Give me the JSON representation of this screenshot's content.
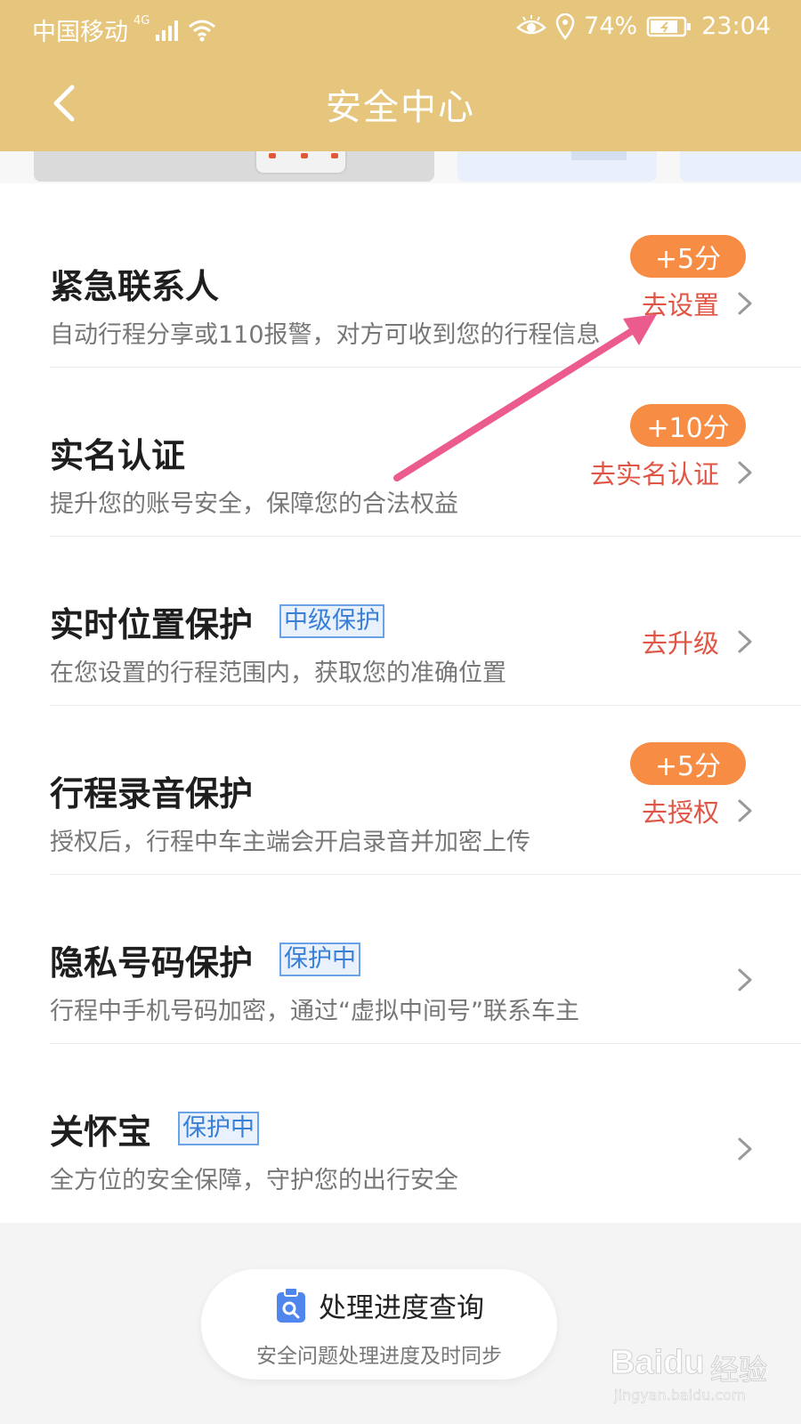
{
  "status_bar": {
    "carrier": "中国移动",
    "network": "4G",
    "battery": "74%",
    "time": "23:04"
  },
  "header": {
    "title": "安全中心"
  },
  "items": [
    {
      "title": "紧急联系人",
      "desc": "自动行程分享或110报警，对方可收到您的行程信息",
      "points": "+5分",
      "action": "去设置"
    },
    {
      "title": "实名认证",
      "desc": "提升您的账号安全，保障您的合法权益",
      "points": "+10分",
      "action": "去实名认证"
    },
    {
      "title": "实时位置保护",
      "tag": "中级保护",
      "desc": "在您设置的行程范围内，获取您的准确位置",
      "action": "去升级"
    },
    {
      "title": "行程录音保护",
      "desc": "授权后，行程中车主端会开启录音并加密上传",
      "points": "+5分",
      "action": "去授权"
    },
    {
      "title": "隐私号码保护",
      "tag": "保护中",
      "desc": "行程中手机号码加密，通过“虚拟中间号”联系车主"
    },
    {
      "title": "关怀宝",
      "tag": "保护中",
      "desc": "全方位的安全保障，守护您的出行安全"
    }
  ],
  "footer": {
    "label": "处理进度查询",
    "sub": "安全问题处理进度及时同步"
  },
  "watermark": {
    "brand": "Baidu",
    "cn": "经验",
    "url": "jingyan.baidu.com"
  },
  "colors": {
    "header": "#e6c57c",
    "points_badge": "#f78c45",
    "action_text": "#e05545",
    "tag_blue": "#3a7fd6",
    "annotation_arrow": "#ec5b8e"
  }
}
